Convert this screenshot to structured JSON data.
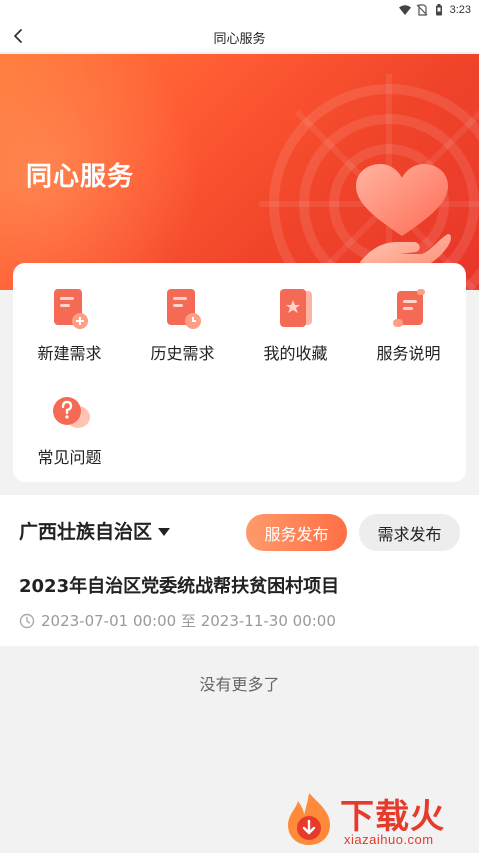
{
  "status_bar": {
    "time": "3:23",
    "icons": [
      "wifi-icon",
      "no-sim-icon",
      "battery-icon"
    ]
  },
  "header": {
    "title": "同心服务",
    "back_icon": "chevron-left-icon"
  },
  "banner": {
    "title": "同心服务",
    "illustration": "heart-in-hand-icon",
    "colors": {
      "start": "#ff7a3a",
      "end": "#e8352a"
    }
  },
  "grid": {
    "items": [
      {
        "label": "新建需求",
        "icon": "new-document-icon"
      },
      {
        "label": "历史需求",
        "icon": "history-document-icon"
      },
      {
        "label": "我的收藏",
        "icon": "favorite-book-icon"
      },
      {
        "label": "服务说明",
        "icon": "scroll-document-icon"
      },
      {
        "label": "常见问题",
        "icon": "question-bubble-icon"
      }
    ]
  },
  "region": {
    "name": "广西壮族自治区",
    "service_button": "服务发布",
    "demand_button": "需求发布"
  },
  "project": {
    "title": "2023年自治区党委统战帮扶贫困村项目",
    "date_range": "2023-07-01 00:00 至 2023-11-30 00:00"
  },
  "list": {
    "no_more_text": "没有更多了"
  },
  "watermark": {
    "text_cn": "下载火",
    "text_en": "xiazaihuo.com"
  },
  "colors": {
    "accent": "#ff5a33",
    "icon_red": "#f25a45"
  }
}
